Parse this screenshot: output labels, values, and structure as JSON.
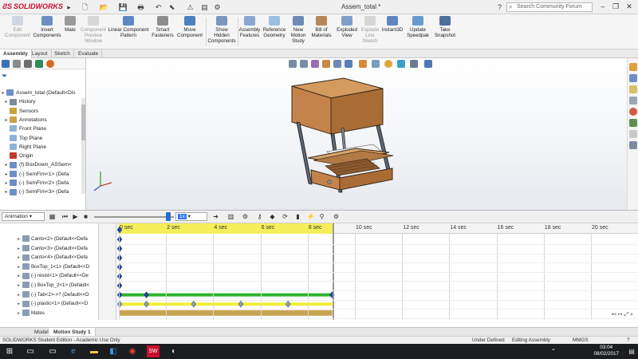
{
  "app": {
    "logo_text": "SOLIDWORKS",
    "document_title": "Assem_total *",
    "search_placeholder": "Search Community Forum"
  },
  "ribbon": {
    "buttons": [
      {
        "name": "edit-component",
        "label": "Edit Component",
        "disabled": true
      },
      {
        "name": "insert-components",
        "label": "Insert Components",
        "disabled": false
      },
      {
        "name": "mate",
        "label": "Mate",
        "disabled": false
      },
      {
        "name": "component-preview-window",
        "label": "Component Preview Window",
        "disabled": true
      },
      {
        "name": "linear-component-pattern",
        "label": "Linear Component Pattern",
        "disabled": false
      },
      {
        "name": "smart-fasteners",
        "label": "Smart Fasteners",
        "disabled": false
      },
      {
        "name": "move-component",
        "label": "Move Component",
        "disabled": false
      },
      {
        "name": "show-hidden-components",
        "label": "Show Hidden Components",
        "disabled": false
      },
      {
        "name": "assembly-features",
        "label": "Assembly Features",
        "disabled": false
      },
      {
        "name": "reference-geometry",
        "label": "Reference Geometry",
        "disabled": false
      },
      {
        "name": "new-motion-study",
        "label": "New Motion Study",
        "disabled": false
      },
      {
        "name": "bill-of-materials",
        "label": "Bill of Materials",
        "disabled": false
      },
      {
        "name": "exploded-view",
        "label": "Exploded View",
        "disabled": false
      },
      {
        "name": "explode-line-sketch",
        "label": "Explode Line Sketch",
        "disabled": true
      },
      {
        "name": "instant3d",
        "label": "Instant3D",
        "disabled": false
      },
      {
        "name": "update-speedpak",
        "label": "Update Speedpak",
        "disabled": false
      },
      {
        "name": "take-snapshot",
        "label": "Take Snapshot",
        "disabled": false
      }
    ]
  },
  "command_tabs": [
    "Assembly",
    "Layout",
    "Sketch",
    "Evaluate"
  ],
  "feature_tree": {
    "items": [
      {
        "label": "Assem_total  (Default<Dis",
        "icon": "assembly-icon",
        "color": "#6c8fc7",
        "indent": 0
      },
      {
        "label": "History",
        "icon": "history-icon",
        "color": "#7d8a99",
        "indent": 1
      },
      {
        "label": "Sensors",
        "icon": "sensors-icon",
        "color": "#caa23a",
        "indent": 1
      },
      {
        "label": "Annotations",
        "icon": "annotations-icon",
        "color": "#c9a44a",
        "indent": 1
      },
      {
        "label": "Front Plane",
        "icon": "plane-icon",
        "color": "#8eb3d6",
        "indent": 1
      },
      {
        "label": "Top Plane",
        "icon": "plane-icon",
        "color": "#8eb3d6",
        "indent": 1
      },
      {
        "label": "Right Plane",
        "icon": "plane-icon",
        "color": "#8eb3d6",
        "indent": 1
      },
      {
        "label": "Origin",
        "icon": "origin-icon",
        "color": "#c0392b",
        "indent": 1
      },
      {
        "label": "(f) BoxDown_ASSem<",
        "icon": "subassembly-icon",
        "color": "#6c8fc7",
        "indent": 1
      },
      {
        "label": "(-) SemFim<1> (Defa",
        "icon": "subassembly-icon",
        "color": "#6c8fc7",
        "indent": 1
      },
      {
        "label": "(-) SemFim<2> (Defa",
        "icon": "subassembly-icon",
        "color": "#6c8fc7",
        "indent": 1
      },
      {
        "label": "(-) SemFim<3> (Defa",
        "icon": "subassembly-icon",
        "color": "#6c8fc7",
        "indent": 1
      }
    ]
  },
  "motion": {
    "study_type": "Animation",
    "speed_value": "1x",
    "time_labels": [
      "0 sec",
      "2 sec",
      "4 sec",
      "6 sec",
      "8 sec",
      "10 sec",
      "12 sec",
      "14 sec",
      "16 sec",
      "18 sec",
      "20 sec"
    ],
    "tree": [
      {
        "label": "Canto<2> (Default<<Defa"
      },
      {
        "label": "Canto<3> (Default<<Defa"
      },
      {
        "label": "Canto<4> (Default<<Defa"
      },
      {
        "label": "BoxTop_1<1> (Default<<D"
      },
      {
        "label": "(-) resist<1> (Default<<De"
      },
      {
        "label": "(-) BoxTop_2<1> (Default<"
      },
      {
        "label": "(-) Tab<2>->? (Default<<D"
      },
      {
        "label": "(-) plastic<1> (Default<<D"
      },
      {
        "label": "Mates"
      }
    ],
    "colors": {
      "green_bar": "#2db52d",
      "yellow_bar": "#f2ee3a",
      "mates_bar": "#c9a454",
      "key": "#1f3fa8",
      "key_gray": "#8e9aa8"
    }
  },
  "bottom_tabs": [
    "Model",
    "Motion Study 1"
  ],
  "status": {
    "left": "SOLIDWORKS Student Edition - Academic Use Only",
    "state": "Under Defined",
    "mode": "Editing Assembly",
    "units": "MMGS"
  },
  "taskbar": {
    "time": "03:04",
    "date": "08/02/2017"
  }
}
